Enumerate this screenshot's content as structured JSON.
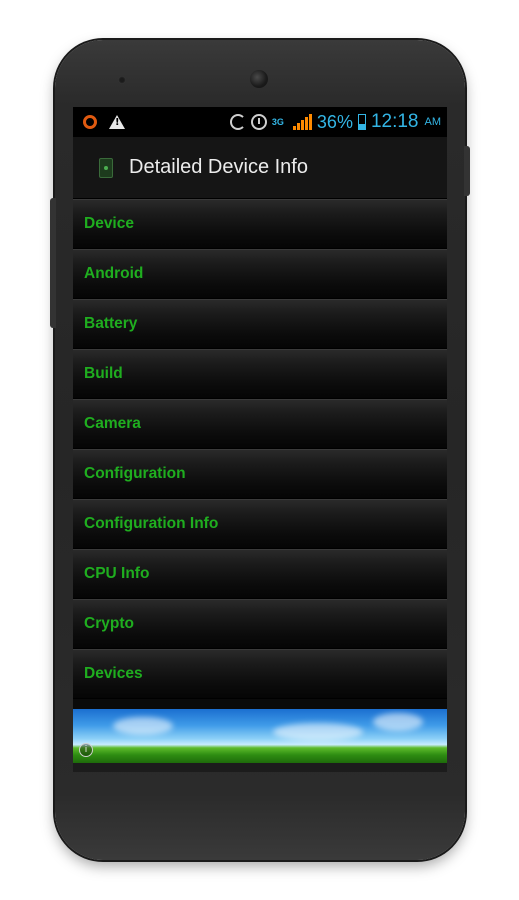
{
  "status_bar": {
    "battery_percent": "36%",
    "time": "12:18",
    "ampm": "AM",
    "network": "3G",
    "icons": [
      "ring-icon",
      "warning-icon",
      "sync-icon",
      "alarm-icon",
      "network-3g-icon",
      "signal-icon",
      "battery-icon"
    ]
  },
  "action_bar": {
    "title": "Detailed Device Info"
  },
  "list": {
    "items": [
      {
        "label": "Device"
      },
      {
        "label": "Android"
      },
      {
        "label": "Battery"
      },
      {
        "label": "Build"
      },
      {
        "label": "Camera"
      },
      {
        "label": "Configuration"
      },
      {
        "label": "Configuration Info"
      },
      {
        "label": "CPU Info"
      },
      {
        "label": "Crypto"
      },
      {
        "label": "Devices"
      }
    ]
  },
  "ad": {
    "info_symbol": "i"
  },
  "colors": {
    "list_label": "#1fae1f",
    "status_accent": "#33b5e5",
    "background": "#0a0a0a"
  }
}
